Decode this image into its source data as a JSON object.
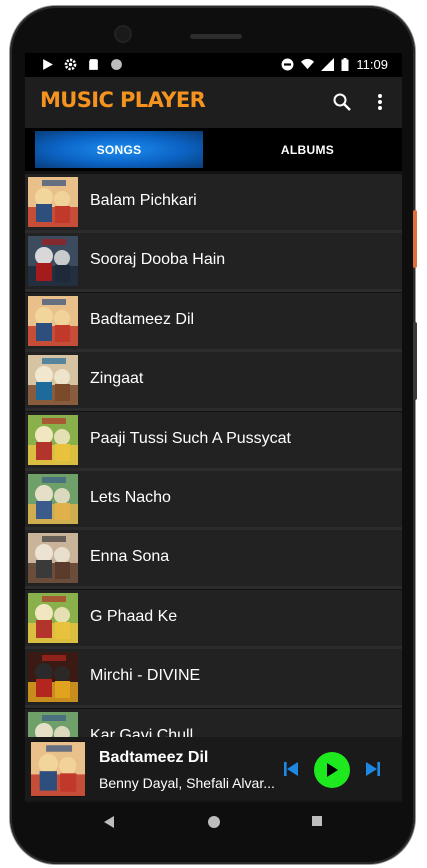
{
  "status_bar": {
    "time": "11:09",
    "left_icons": [
      "play-icon",
      "gear-icon",
      "sd-card-icon",
      "circle-icon"
    ],
    "right_icons": [
      "do-not-disturb-icon",
      "wifi-icon",
      "signal-icon",
      "battery-icon"
    ]
  },
  "app_bar": {
    "title": "MUSIC PLAYER",
    "title_color": "#f49320",
    "actions": [
      "search-icon",
      "more-vert-icon"
    ]
  },
  "tabs": [
    {
      "label": "SONGS",
      "selected": true
    },
    {
      "label": "ALBUMS",
      "selected": false
    }
  ],
  "songs": [
    {
      "title": "Balam Pichkari",
      "art": "yjhd"
    },
    {
      "title": "Sooraj Dooba Hain",
      "art": "roy"
    },
    {
      "title": "Badtameez Dil",
      "art": "yjhd"
    },
    {
      "title": "Zingaat",
      "art": "sairat"
    },
    {
      "title": "Paaji Tussi Such A Pussycat",
      "art": "happy"
    },
    {
      "title": "Lets Nacho",
      "art": "kapoor"
    },
    {
      "title": "Enna Sona",
      "art": "ok"
    },
    {
      "title": "G Phaad Ke",
      "art": "happy"
    },
    {
      "title": "Mirchi - DIVINE",
      "art": "mirchi"
    },
    {
      "title": "Kar Gayi Chull",
      "art": "kapoor"
    }
  ],
  "now_playing": {
    "title": "Badtameez Dil",
    "artist": "Benny Dayal, Shefali Alvar...",
    "controls": [
      "skip-previous-icon",
      "play-icon",
      "skip-next-icon"
    ],
    "accent_color": "#1ee81e",
    "control_color": "#1e88e5"
  },
  "nav_bar": [
    "back-icon",
    "home-icon",
    "recents-icon"
  ]
}
